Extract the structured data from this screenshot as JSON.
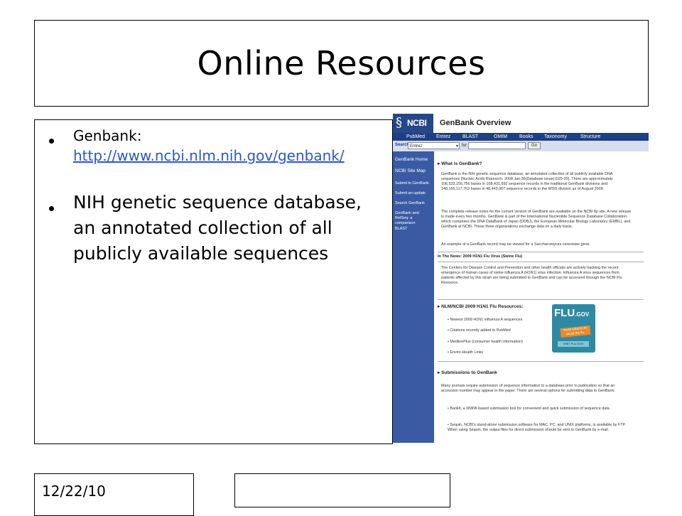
{
  "slide": {
    "title": "Online Resources",
    "bullets": {
      "b1_label": "Genbank:",
      "b1_link": "http://www.ncbi.nlm.nih.gov/genbank/",
      "b2_text": "NIH genetic sequence database, an annotated collection of all publicly available sequences"
    },
    "date": "12/22/10",
    "footer": ""
  },
  "genbank": {
    "logo": "NCBI",
    "page_title": "GenBank Overview",
    "nav": [
      "PubMed",
      "Entrez",
      "BLAST",
      "OMIM",
      "Books",
      "Taxonomy",
      "Structure"
    ],
    "search_label": "Search",
    "search_db": "Entrez",
    "for_label": "for",
    "go_label": "Go",
    "sidebar": [
      "GenBank Home",
      "NCBI Site Map",
      "Submit to GenBank",
      "Submit an update",
      "Search GenBank",
      "GenBank and RefSeq: a comparison",
      "BLAST"
    ],
    "h_what": "What is GenBank?",
    "p_what1": "GenBank is the NIH genetic sequence database, an annotated collection of all publicly available DNA sequences (Nucleic Acids Research, 2008 Jan;36(Database issue):D25-30). There are approximately 106,533,156,756 bases in 108,431,692 sequence records in the traditional GenBank divisions and 148,165,117,763 bases in 48,443,067 sequence records in the WGS division as of August 2009.",
    "p_what2": "The complete release notes for the current version of GenBank are available on the NCBI ftp site. A new release is made every two months. GenBank is part of the International Nucleotide Sequence Database Collaboration, which comprises the DNA DataBank of Japan (DDBJ), the European Molecular Biology Laboratory (EMBL), and GenBank at NCBI. These three organizations exchange data on a daily basis.",
    "p_what3": "An example of a GenBank record may be viewed for a Saccharomyces cerevisiae gene.",
    "h_news": "In The News: 2009 H1N1 Flu Virus (Swine Flu)",
    "p_news": "The Centers for Disease Control and Prevention and other health officials are actively tracking the recent emergence of human cases of swine influenza A (H1N1) virus infection. Influenza A virus sequences from patients affected by this strain are being submitted to GenBank and can be accessed through the NCBI Flu Resource.",
    "h_flu": "NLM/NCBI 2009 H1N1 Flu Resources:",
    "flu_items": [
      "Newest 2009 H1N1 influenza A sequences",
      "Citations recently added to PubMed",
      "MedlinePlus (consumer health information)",
      "Enviro-Health Links"
    ],
    "flu_badge": {
      "word": "FLU",
      "tld": ".GOV",
      "tag": "Know what to do about the flu.",
      "btn": "VISIT FLU.GOV"
    },
    "h_sub": "Submissions to GenBank",
    "p_sub": "Many journals require submission of sequence information to a database prior to publication so that an accession number may appear in the paper. There are several options for submitting data to GenBank:",
    "sub_items": [
      "BankIt, a WWW-based submission tool for convenient and quick submission of sequence data",
      "Sequin, NCBI's stand-alone submission software for MAC, PC, and UNIX platforms, is available by FTP. When using Sequin, the output files for direct submission should be sent to GenBank by e-mail."
    ]
  }
}
